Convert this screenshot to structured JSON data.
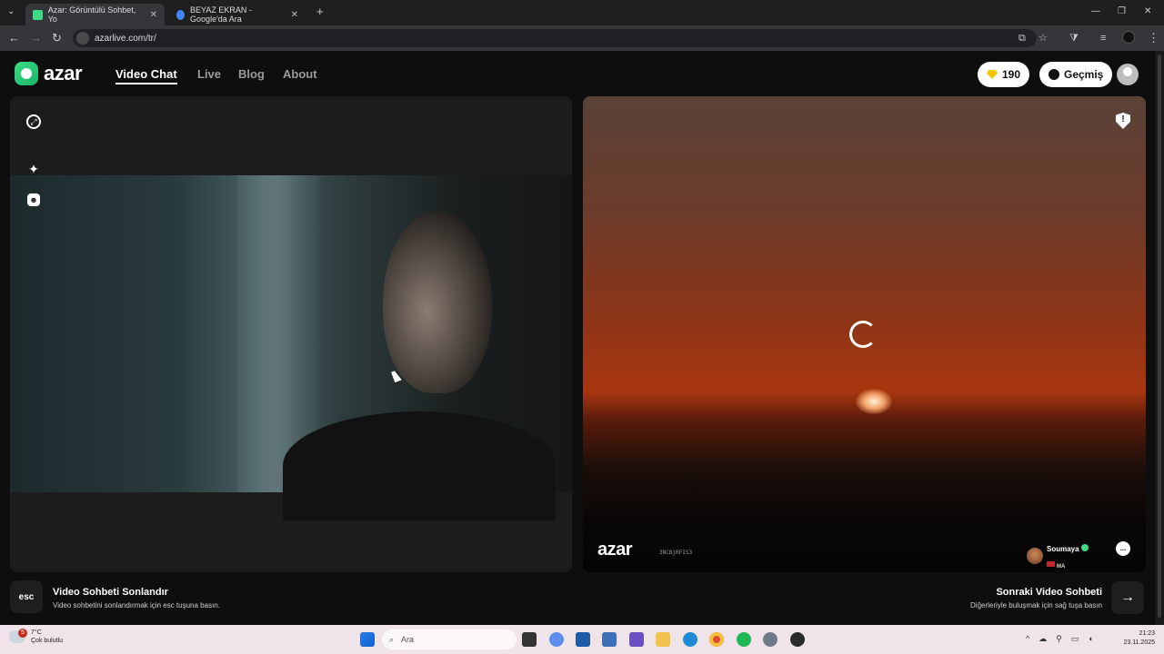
{
  "browser": {
    "tabs": [
      {
        "title": "Azar: Görüntülü Sohbet, Yo",
        "favicon_color": "#3ddc84"
      },
      {
        "title": "BEYAZ EKRAN - Google'da Ara",
        "favicon_color": "#4285f4"
      }
    ],
    "new_tab_label": "+",
    "url": "azarlive.com/tr/"
  },
  "header": {
    "logo_text": "azar",
    "nav": [
      "Video Chat",
      "Live",
      "Blog",
      "About"
    ],
    "gems": "190",
    "history_label": "Geçmiş"
  },
  "remote": {
    "watermark": "azar",
    "code": "3NCBjRFIS3",
    "peer_name": "Soumaya",
    "peer_country": "MA",
    "report_icon": "!",
    "chat_icon": "..."
  },
  "footer": {
    "esc_key": "esc",
    "end_title": "Video Sohbeti Sonlandır",
    "end_sub": "Video sohbetini sonlandırmak için esc tuşuna basın.",
    "next_title": "Sonraki Video Sohbeti",
    "next_sub": "Diğerleriyle buluşmak için sağ tuşa basın",
    "next_arrow": "→"
  },
  "taskbar": {
    "weather_badge": "5",
    "temperature": "7°C",
    "weather_desc": "Çok bulutlu",
    "search_placeholder": "Ara",
    "time": "21:23",
    "date": "23.11.2025"
  },
  "colors": {
    "brand": "#3ddc84",
    "gem": "#f5c400",
    "taskbar": "#f0e4ea"
  }
}
